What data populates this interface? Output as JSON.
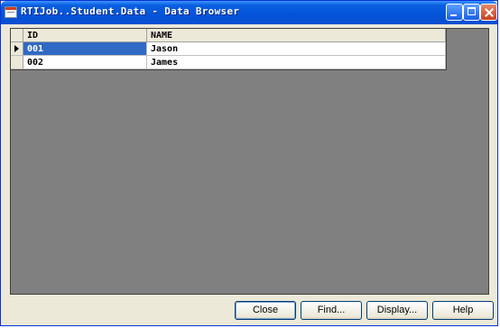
{
  "window": {
    "title": "RTIJob..Student.Data - Data Browser",
    "icon": "table-window-icon"
  },
  "grid": {
    "columns": [
      "ID",
      "NAME"
    ],
    "rows": [
      {
        "id": "001",
        "name": "Jason",
        "current": true
      },
      {
        "id": "002",
        "name": "James",
        "current": false
      }
    ],
    "selection_color": "#316ac5"
  },
  "buttons": {
    "close": "Close",
    "find": "Find...",
    "display": "Display...",
    "help": "Help"
  }
}
